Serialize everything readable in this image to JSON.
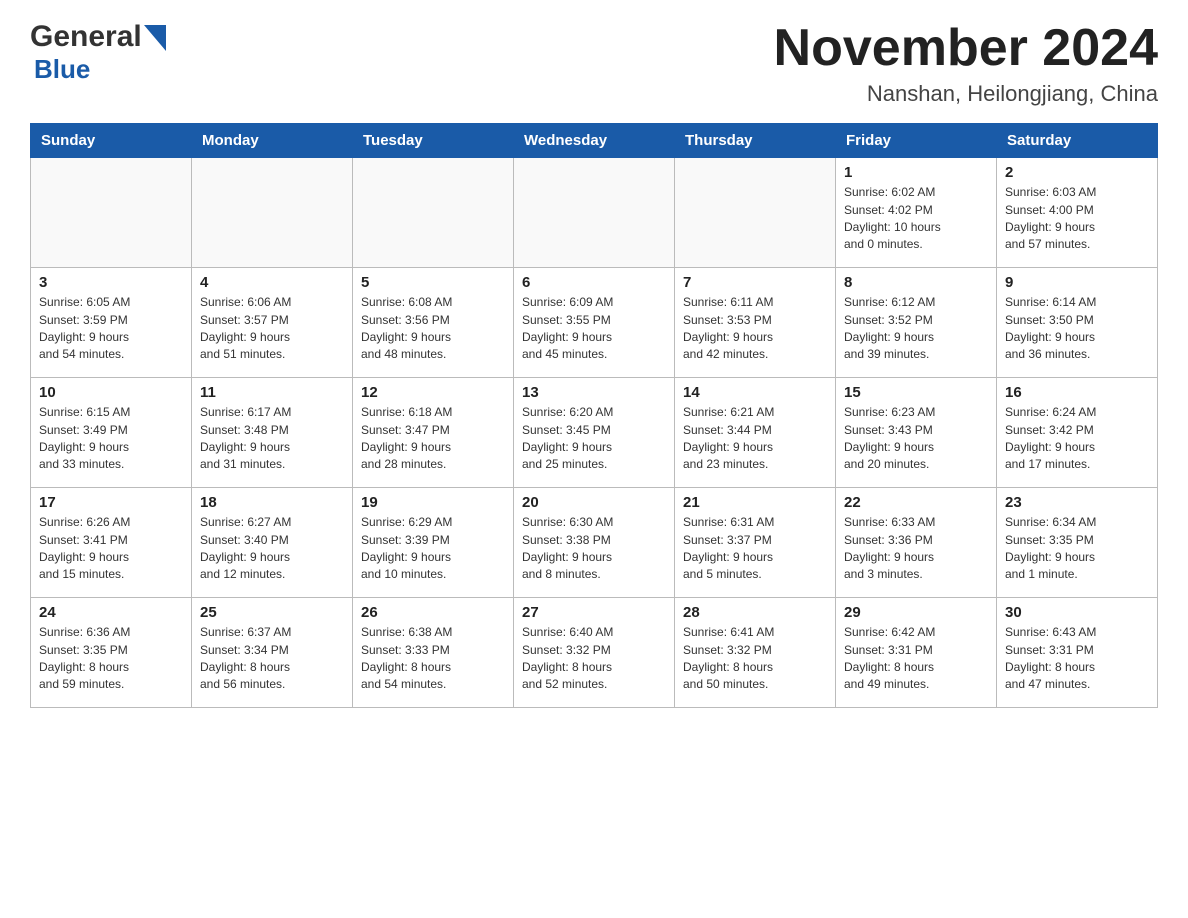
{
  "header": {
    "logo_general": "General",
    "logo_blue": "Blue",
    "month_title": "November 2024",
    "location": "Nanshan, Heilongjiang, China"
  },
  "weekdays": [
    "Sunday",
    "Monday",
    "Tuesday",
    "Wednesday",
    "Thursday",
    "Friday",
    "Saturday"
  ],
  "weeks": [
    [
      {
        "day": "",
        "info": ""
      },
      {
        "day": "",
        "info": ""
      },
      {
        "day": "",
        "info": ""
      },
      {
        "day": "",
        "info": ""
      },
      {
        "day": "",
        "info": ""
      },
      {
        "day": "1",
        "info": "Sunrise: 6:02 AM\nSunset: 4:02 PM\nDaylight: 10 hours\nand 0 minutes."
      },
      {
        "day": "2",
        "info": "Sunrise: 6:03 AM\nSunset: 4:00 PM\nDaylight: 9 hours\nand 57 minutes."
      }
    ],
    [
      {
        "day": "3",
        "info": "Sunrise: 6:05 AM\nSunset: 3:59 PM\nDaylight: 9 hours\nand 54 minutes."
      },
      {
        "day": "4",
        "info": "Sunrise: 6:06 AM\nSunset: 3:57 PM\nDaylight: 9 hours\nand 51 minutes."
      },
      {
        "day": "5",
        "info": "Sunrise: 6:08 AM\nSunset: 3:56 PM\nDaylight: 9 hours\nand 48 minutes."
      },
      {
        "day": "6",
        "info": "Sunrise: 6:09 AM\nSunset: 3:55 PM\nDaylight: 9 hours\nand 45 minutes."
      },
      {
        "day": "7",
        "info": "Sunrise: 6:11 AM\nSunset: 3:53 PM\nDaylight: 9 hours\nand 42 minutes."
      },
      {
        "day": "8",
        "info": "Sunrise: 6:12 AM\nSunset: 3:52 PM\nDaylight: 9 hours\nand 39 minutes."
      },
      {
        "day": "9",
        "info": "Sunrise: 6:14 AM\nSunset: 3:50 PM\nDaylight: 9 hours\nand 36 minutes."
      }
    ],
    [
      {
        "day": "10",
        "info": "Sunrise: 6:15 AM\nSunset: 3:49 PM\nDaylight: 9 hours\nand 33 minutes."
      },
      {
        "day": "11",
        "info": "Sunrise: 6:17 AM\nSunset: 3:48 PM\nDaylight: 9 hours\nand 31 minutes."
      },
      {
        "day": "12",
        "info": "Sunrise: 6:18 AM\nSunset: 3:47 PM\nDaylight: 9 hours\nand 28 minutes."
      },
      {
        "day": "13",
        "info": "Sunrise: 6:20 AM\nSunset: 3:45 PM\nDaylight: 9 hours\nand 25 minutes."
      },
      {
        "day": "14",
        "info": "Sunrise: 6:21 AM\nSunset: 3:44 PM\nDaylight: 9 hours\nand 23 minutes."
      },
      {
        "day": "15",
        "info": "Sunrise: 6:23 AM\nSunset: 3:43 PM\nDaylight: 9 hours\nand 20 minutes."
      },
      {
        "day": "16",
        "info": "Sunrise: 6:24 AM\nSunset: 3:42 PM\nDaylight: 9 hours\nand 17 minutes."
      }
    ],
    [
      {
        "day": "17",
        "info": "Sunrise: 6:26 AM\nSunset: 3:41 PM\nDaylight: 9 hours\nand 15 minutes."
      },
      {
        "day": "18",
        "info": "Sunrise: 6:27 AM\nSunset: 3:40 PM\nDaylight: 9 hours\nand 12 minutes."
      },
      {
        "day": "19",
        "info": "Sunrise: 6:29 AM\nSunset: 3:39 PM\nDaylight: 9 hours\nand 10 minutes."
      },
      {
        "day": "20",
        "info": "Sunrise: 6:30 AM\nSunset: 3:38 PM\nDaylight: 9 hours\nand 8 minutes."
      },
      {
        "day": "21",
        "info": "Sunrise: 6:31 AM\nSunset: 3:37 PM\nDaylight: 9 hours\nand 5 minutes."
      },
      {
        "day": "22",
        "info": "Sunrise: 6:33 AM\nSunset: 3:36 PM\nDaylight: 9 hours\nand 3 minutes."
      },
      {
        "day": "23",
        "info": "Sunrise: 6:34 AM\nSunset: 3:35 PM\nDaylight: 9 hours\nand 1 minute."
      }
    ],
    [
      {
        "day": "24",
        "info": "Sunrise: 6:36 AM\nSunset: 3:35 PM\nDaylight: 8 hours\nand 59 minutes."
      },
      {
        "day": "25",
        "info": "Sunrise: 6:37 AM\nSunset: 3:34 PM\nDaylight: 8 hours\nand 56 minutes."
      },
      {
        "day": "26",
        "info": "Sunrise: 6:38 AM\nSunset: 3:33 PM\nDaylight: 8 hours\nand 54 minutes."
      },
      {
        "day": "27",
        "info": "Sunrise: 6:40 AM\nSunset: 3:32 PM\nDaylight: 8 hours\nand 52 minutes."
      },
      {
        "day": "28",
        "info": "Sunrise: 6:41 AM\nSunset: 3:32 PM\nDaylight: 8 hours\nand 50 minutes."
      },
      {
        "day": "29",
        "info": "Sunrise: 6:42 AM\nSunset: 3:31 PM\nDaylight: 8 hours\nand 49 minutes."
      },
      {
        "day": "30",
        "info": "Sunrise: 6:43 AM\nSunset: 3:31 PM\nDaylight: 8 hours\nand 47 minutes."
      }
    ]
  ]
}
